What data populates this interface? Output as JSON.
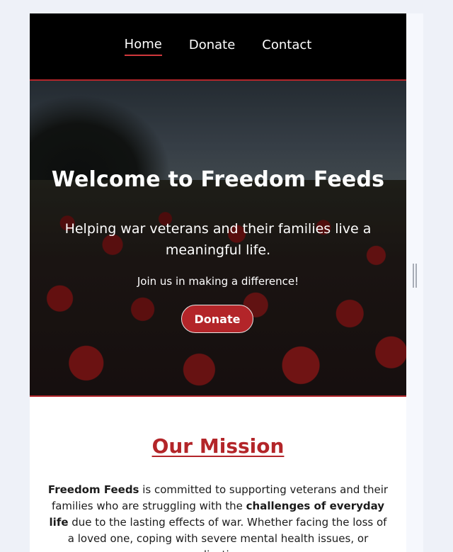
{
  "nav": {
    "items": [
      {
        "label": "Home",
        "active": true
      },
      {
        "label": "Donate",
        "active": false
      },
      {
        "label": "Contact",
        "active": false
      }
    ]
  },
  "hero": {
    "title": "Welcome to Freedom Feeds",
    "subtitle": "Helping war veterans and their families live a meaningful life.",
    "cta_text": "Join us in making a difference!",
    "button_label": "Donate"
  },
  "mission": {
    "title": "Our Mission",
    "org_name": "Freedom Feeds",
    "text_1": " is committed to supporting veterans and their families who are struggling with the ",
    "highlight": "challenges of everyday life",
    "text_2": " due to the lasting effects of war. Whether facing the loss of a loved one, coping with severe mental health issues, or adjusting"
  },
  "colors": {
    "accent": "#b32529",
    "nav_bg": "#000000",
    "page_bg": "#eef1f8"
  }
}
